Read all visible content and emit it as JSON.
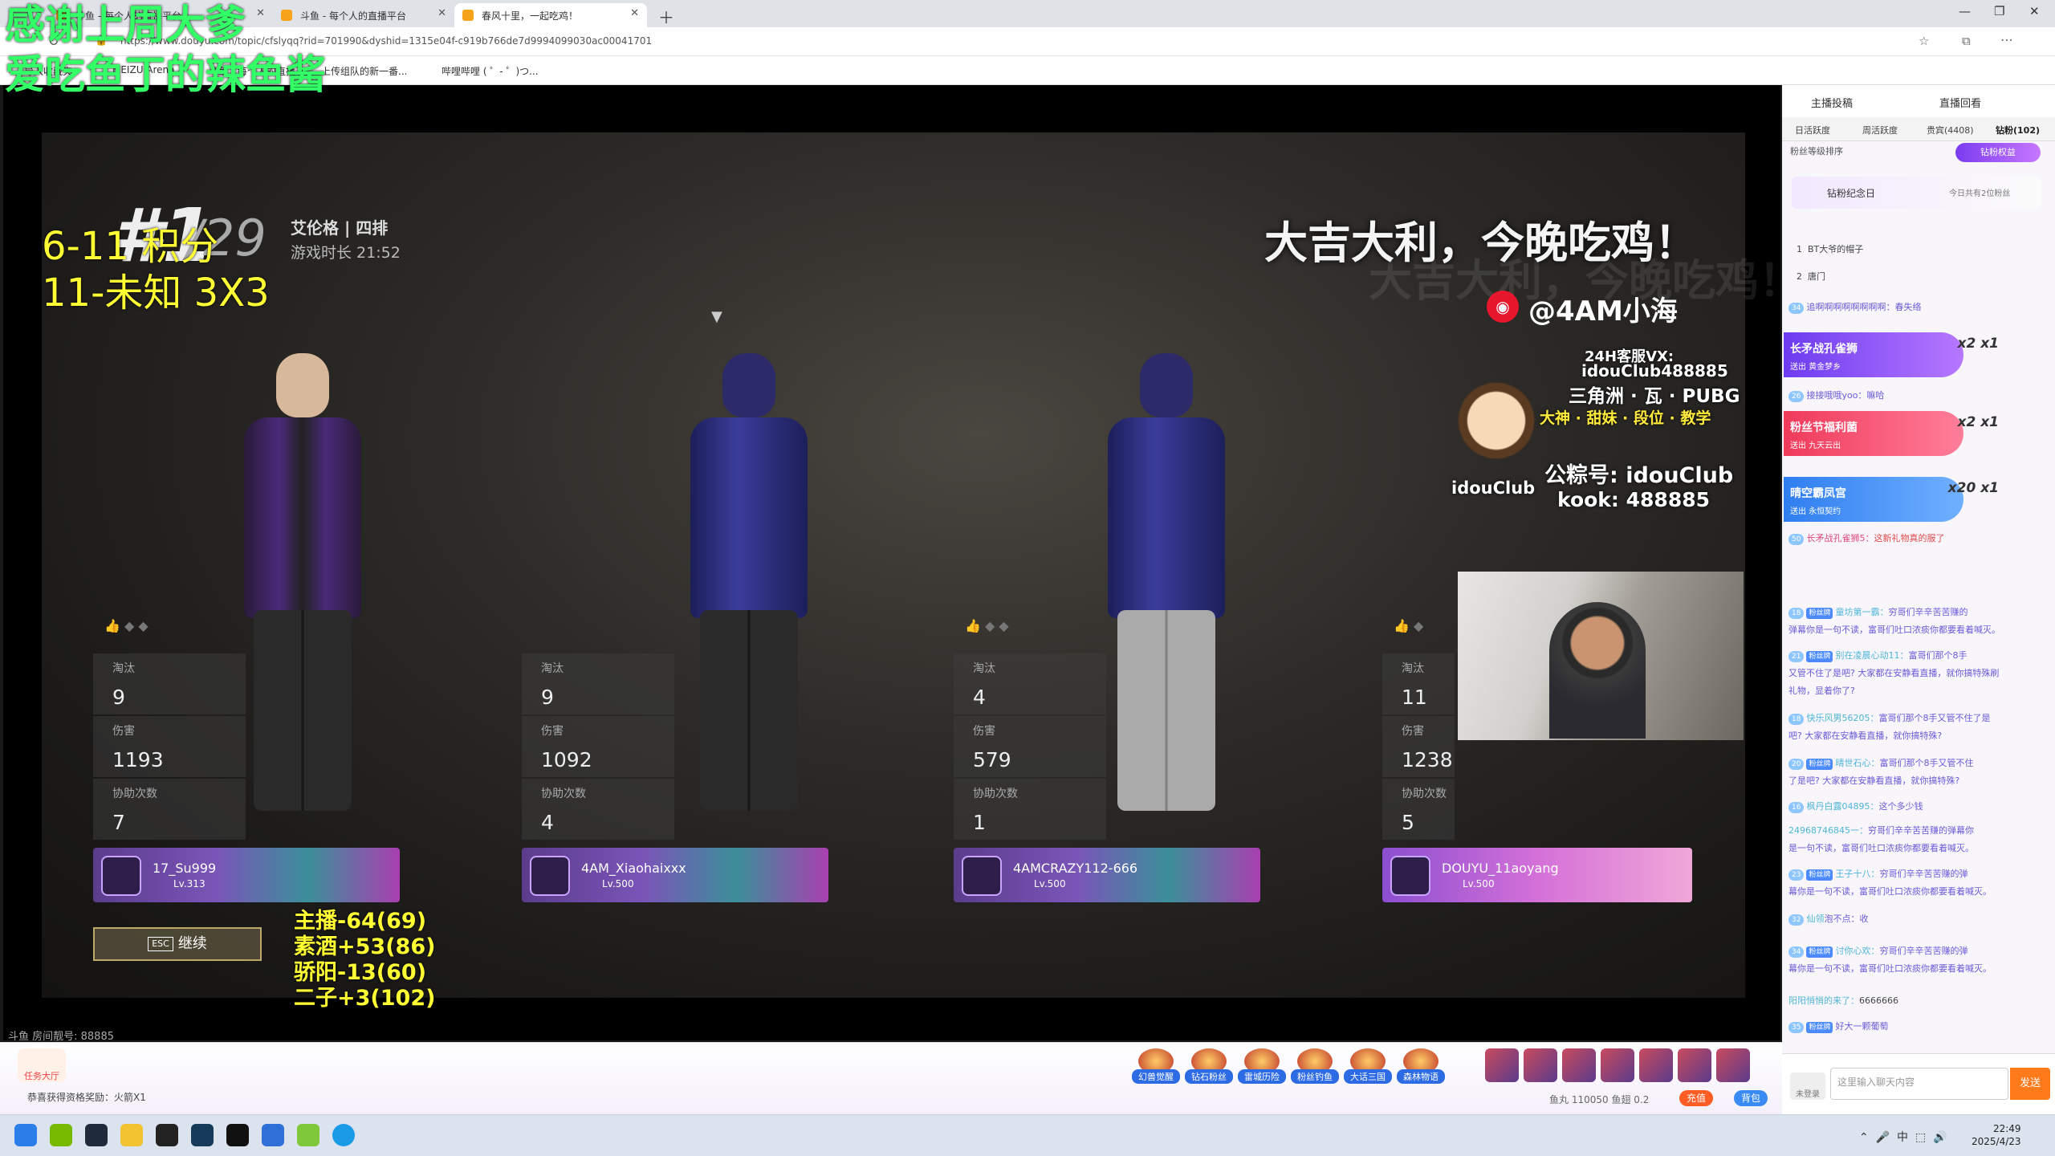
{
  "browser": {
    "tabs": [
      {
        "title": "斗鱼 - 每个人的直播平台"
      },
      {
        "title": "斗鱼 - 每个人的直播平台"
      },
      {
        "title": "春风十里，一起吃鸡！"
      }
    ],
    "url": "https://www.douyu.com/topic/cfslyqq?rid=701990&dyshid=1315e04f-c919b766de7d9994099030ac00041701",
    "bookmarks": [
      "导入收藏夹",
      "MEIZU Arena",
      "斗鱼 - 每个人的直播",
      "上传组队的新一番...",
      "哔哩哔哩 ( ゜- ゜)つ..."
    ]
  },
  "overlay": {
    "text": "感谢上周大爹\n爱吃鱼丁的辣鱼酱"
  },
  "game": {
    "rank": "#1",
    "rank_total": "/29",
    "map": "艾伦格 | 四排",
    "duration": "游戏时长 21:52",
    "victory": "大吉大利，今晚吃鸡！",
    "weibo": "@4AM小海",
    "promo": {
      "line1": "24H客服VX:",
      "line2": "idouClub488885",
      "line3": "三角洲 · 瓦 · PUBG",
      "line4": "大神 · 甜妹 · 段位 · 教学",
      "line5": "公粽号: idouClub",
      "line6": "kook: 488885",
      "brand": "idouClub"
    },
    "score_top": "6-11 积分\n11-未知 3X3",
    "score_lower": "主播-64(69)\n素酒+53(86)\n骄阳-13(60)\n二子+3(102)",
    "stat_labels": {
      "kills": "淘汰",
      "damage": "伤害",
      "assists": "协助次数"
    },
    "players": [
      {
        "name": "17_Su999",
        "level": "Lv.313",
        "kills": "9",
        "damage": "1193",
        "assists": "7"
      },
      {
        "name": "4AM_Xiaohaixxx",
        "level": "Lv.500",
        "kills": "9",
        "damage": "1092",
        "assists": "4"
      },
      {
        "name": "4AMCRAZY112-666",
        "level": "Lv.500",
        "kills": "4",
        "damage": "579",
        "assists": "1"
      },
      {
        "name": "DOUYU_11aoyang",
        "level": "Lv.500",
        "kills": "11",
        "damage": "1238",
        "assists": "5"
      }
    ],
    "esc_key": "ESC",
    "continue_label": "继续",
    "room_id": "斗鱼 房间靓号: 88885"
  },
  "bottom_bar": {
    "task_hall": "任务大厅",
    "ticker": "恭喜获得资格奖励：火箭X1",
    "gifts": [
      "幻兽觉醒",
      "钻石粉丝",
      "雷城历险",
      "粉丝钓鱼",
      "大话三国",
      "森林物语"
    ],
    "balance": "鱼丸 110050   鱼翅 0.2",
    "charge": "充值",
    "bag": "背包"
  },
  "panel": {
    "top_tabs": [
      "主播投稿",
      "直播回看"
    ],
    "sub_tabs": [
      "日活跃度",
      "周活跃度",
      "贵宾(4408)",
      "钻粉(102)"
    ],
    "rank_label": "粉丝等级排序",
    "diamond_btn": "钻粉权益",
    "memorial": "钻粉纪念日",
    "memorial_sub": "今日共有2位粉丝",
    "fans": [
      "BT大爷的帽子",
      "唐门"
    ],
    "gift_banners": [
      {
        "title": "长矛战孔雀狮",
        "sub": "送出  黄金梦乡",
        "count": "x2 x1"
      },
      {
        "title": "粉丝节福利菌",
        "sub": "送出  九天云出",
        "count": "x2 x1"
      },
      {
        "title": "晴空霸凤宫",
        "sub": "送出  永恒契约",
        "count": "x20 x1"
      }
    ],
    "chats": [
      {
        "lv": "34",
        "name": "",
        "text": "追啊啊啊啊啊啊啊啊：春失络"
      },
      {
        "lv": "26",
        "name": "",
        "text": "接接哦哦yoo：嘛哈"
      },
      {
        "lv": "50",
        "name": "长矛战孔雀狮5：",
        "text": "这新礼物真的服了"
      },
      {
        "lv": "18",
        "name": "童坊第一霸：",
        "text": "穷哥们辛辛苦苦赚的"
      },
      {
        "lv": "",
        "name": "",
        "text": "弹幕你是一句不读，富哥们吐口浓痰你都要看着喊灭。"
      },
      {
        "lv": "21",
        "name": "别在凌晨心动11：",
        "text": "富哥们那个8手"
      },
      {
        "lv": "",
        "name": "",
        "text": "又管不住了是吧? 大家都在安静看直播，就你搞特殊刷"
      },
      {
        "lv": "",
        "name": "",
        "text": "礼物，显着你了?"
      },
      {
        "lv": "18",
        "name": "快乐风男56205：",
        "text": "富哥们那个8手又管不住了是"
      },
      {
        "lv": "",
        "name": "",
        "text": "吧? 大家都在安静看直播，就你搞特殊?"
      },
      {
        "lv": "20",
        "name": "晴世石心：",
        "text": "富哥们那个8手又管不住"
      },
      {
        "lv": "",
        "name": "",
        "text": "了是吧? 大家都在安静看直播，就你搞特殊?"
      },
      {
        "lv": "16",
        "name": "枫丹白露04895：",
        "text": "这个多少钱"
      },
      {
        "lv": "",
        "name": "24968746845一：",
        "text": "穷哥们辛辛苦苦赚的弹幕你"
      },
      {
        "lv": "",
        "name": "",
        "text": "是一句不读，富哥们吐口浓痰你都要看着喊灭。"
      },
      {
        "lv": "23",
        "name": "王子十八：",
        "text": "穷哥们辛辛苦苦赚的弹"
      },
      {
        "lv": "",
        "name": "",
        "text": "幕你是一句不读，富哥们吐口浓痰你都要看着喊灭。"
      },
      {
        "lv": "32",
        "name": "仙领",
        "text": "泡不点：收"
      },
      {
        "lv": "34",
        "name": "讨你心欢：",
        "text": "穷哥们辛辛苦苦赚的弹"
      },
      {
        "lv": "",
        "name": "",
        "text": "幕你是一句不读，富哥们吐口浓痰你都要看着喊灭。"
      },
      {
        "lv": "",
        "name": "阳阳悄悄的来了：",
        "text": "6666666"
      },
      {
        "lv": "35",
        "name": "",
        "text": "好大一颗葡萄"
      }
    ],
    "input_placeholder": "这里输入聊天内容",
    "send": "发送",
    "unlogged": "未登录"
  },
  "taskbar": {
    "time": "22:49",
    "date": "2025/4/23",
    "tray": "中"
  },
  "colors": {
    "overlay": "#33ff66",
    "score": "#ffff33",
    "accent": "#ff7a1a"
  }
}
